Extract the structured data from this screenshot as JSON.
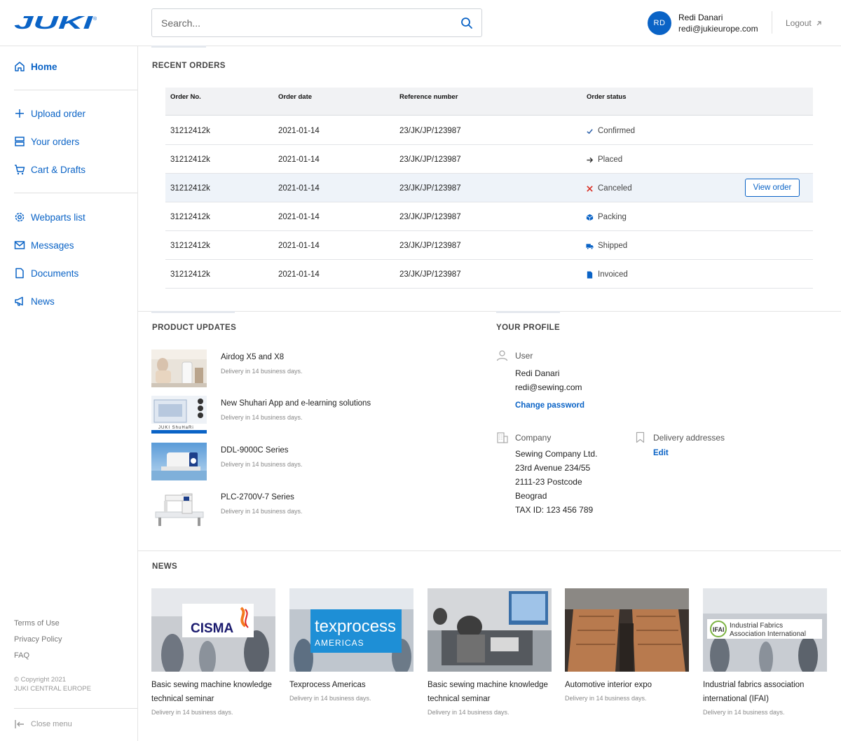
{
  "header": {
    "brand": "JUKI",
    "search_placeholder": "Search...",
    "user": {
      "initials": "RD",
      "name": "Redi Danari",
      "email": "redi@jukieurope.com"
    },
    "logout_label": "Logout"
  },
  "sidebar": {
    "home": "Home",
    "group1": [
      "Upload order",
      "Your orders",
      "Cart & Drafts"
    ],
    "group2": [
      "Webparts list",
      "Messages",
      "Documents",
      "News"
    ],
    "footer_links": [
      "Terms of Use",
      "Privacy Policy",
      "FAQ"
    ],
    "copyright_line1": "© Copyright 2021",
    "copyright_line2": "JUKI CENTRAL EUROPE",
    "close_menu": "Close menu"
  },
  "recent_orders": {
    "title": "RECENT ORDERS",
    "columns": [
      "Order No.",
      "Order date",
      "Reference number",
      "Order status"
    ],
    "rows": [
      {
        "no": "31212412k",
        "date": "2021-01-14",
        "ref": "23/JK/JP/123987",
        "status": "Confirmed",
        "status_icon": "check-icon",
        "color": "#2a5ea8"
      },
      {
        "no": "31212412k",
        "date": "2021-01-14",
        "ref": "23/JK/JP/123987",
        "status": "Placed",
        "status_icon": "arrow-right-icon",
        "color": "#333333"
      },
      {
        "no": "31212412k",
        "date": "2021-01-14",
        "ref": "23/JK/JP/123987",
        "status": "Canceled",
        "status_icon": "cross-icon",
        "color": "#d93025"
      },
      {
        "no": "31212412k",
        "date": "2021-01-14",
        "ref": "23/JK/JP/123987",
        "status": "Packing",
        "status_icon": "box-icon",
        "color": "#0a63c6"
      },
      {
        "no": "31212412k",
        "date": "2021-01-14",
        "ref": "23/JK/JP/123987",
        "status": "Shipped",
        "status_icon": "truck-icon",
        "color": "#0a63c6"
      },
      {
        "no": "31212412k",
        "date": "2021-01-14",
        "ref": "23/JK/JP/123987",
        "status": "Invoiced",
        "status_icon": "document-icon",
        "color": "#0a63c6"
      }
    ],
    "view_order_label": "View order"
  },
  "product_updates": {
    "title": "PRODUCT UPDATES",
    "items": [
      {
        "name": "Airdog X5 and X8",
        "delivery": "Delivery in 14 business days."
      },
      {
        "name": "New Shuhari App and e-learning solutions",
        "delivery": "Delivery in 14 business days."
      },
      {
        "name": "DDL-9000C Series",
        "delivery": "Delivery in 14 business days."
      },
      {
        "name": "PLC-2700V-7 Series",
        "delivery": "Delivery in 14 business days."
      }
    ]
  },
  "profile": {
    "title": "YOUR PROFILE",
    "user_label": "User",
    "user_name": "Redi Danari",
    "user_email": "redi@sewing.com",
    "change_password": "Change password",
    "company_label": "Company",
    "company_lines": [
      "Sewing Company Ltd.",
      "23rd Avenue 234/55",
      "2111-23 Postcode",
      "Beograd",
      "TAX ID: 123 456 789"
    ],
    "delivery_label": "Delivery addresses",
    "edit_label": "Edit"
  },
  "news": {
    "title": "NEWS",
    "items": [
      {
        "title": "Basic sewing machine knowledge technical seminar",
        "delivery": "Delivery in 14 business days.",
        "logo": "CISMA"
      },
      {
        "title": "Texprocess Americas",
        "delivery": "Delivery in 14 business days.",
        "logo": "texprocess",
        "logo_sub": "AMERICAS"
      },
      {
        "title": "Basic sewing machine knowledge technical seminar",
        "delivery": "Delivery in 14 business days."
      },
      {
        "title": "Automotive interior expo",
        "delivery": "Delivery in 14 business days."
      },
      {
        "title": "Industrial fabrics association international (IFAI)",
        "delivery": "Delivery in 14 business days.",
        "logo": "IFAI",
        "logo_line1": "Industrial Fabrics",
        "logo_line2": "Association International"
      }
    ]
  },
  "colors": {
    "accent": "#0a63c6",
    "highlight_row": "#eef3f9",
    "header_bg": "#f1f2f4"
  }
}
